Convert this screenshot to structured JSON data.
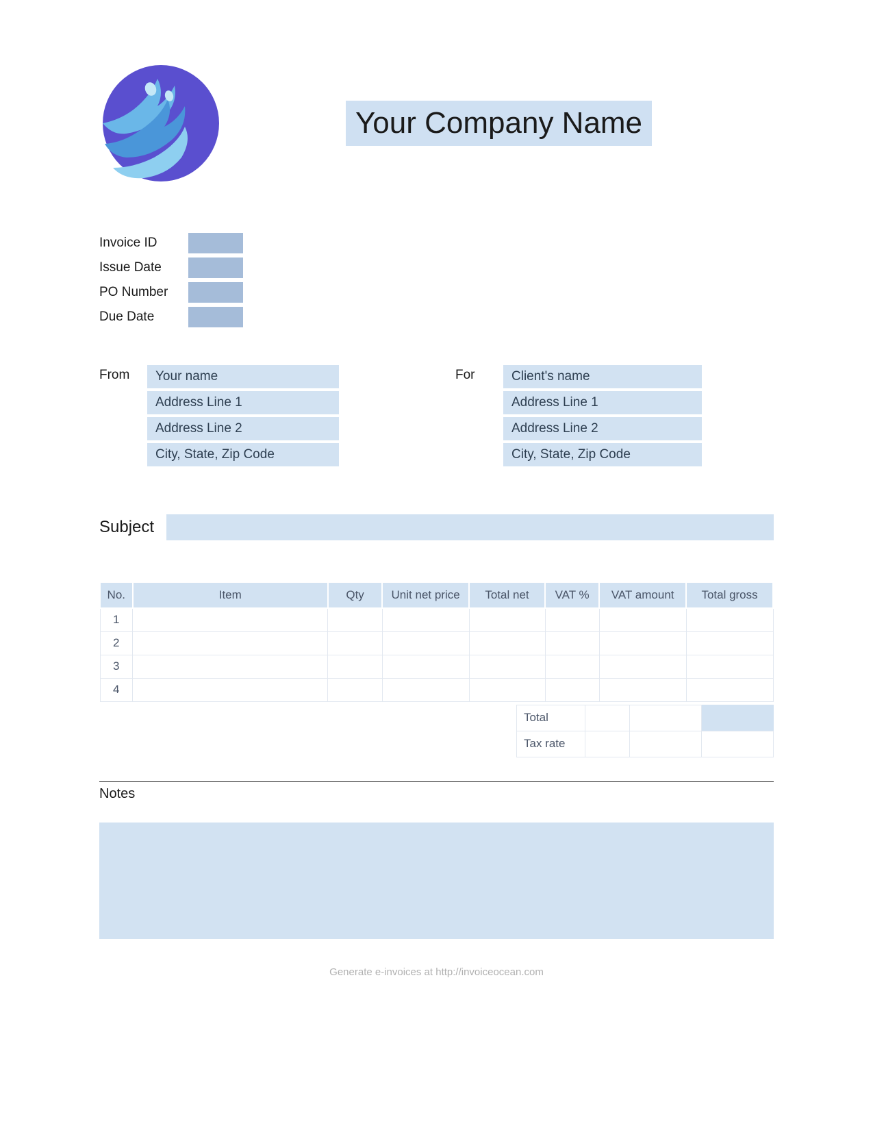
{
  "company_name": "Your Company Name",
  "meta": {
    "invoice_id_label": "Invoice ID",
    "invoice_id": "",
    "issue_date_label": "Issue Date",
    "issue_date": "",
    "po_number_label": "PO Number",
    "po_number": "",
    "due_date_label": "Due Date",
    "due_date": ""
  },
  "from": {
    "label": "From",
    "name": "Your name",
    "address1": "Address Line 1",
    "address2": "Address Line 2",
    "city": "City, State, Zip Code"
  },
  "for": {
    "label": "For",
    "name": "Client's name",
    "address1": "Address Line 1",
    "address2": "Address Line 2",
    "city": "City, State, Zip Code"
  },
  "subject_label": "Subject",
  "subject": "",
  "table": {
    "headers": {
      "no": "No.",
      "item": "Item",
      "qty": "Qty",
      "unit_net_price": "Unit net price",
      "total_net": "Total net",
      "vat_pct": "VAT %",
      "vat_amount": "VAT amount",
      "total_gross": "Total gross"
    },
    "rows": [
      {
        "no": "1",
        "item": "",
        "qty": "",
        "unit_net_price": "",
        "total_net": "",
        "vat_pct": "",
        "vat_amount": "",
        "total_gross": ""
      },
      {
        "no": "2",
        "item": "",
        "qty": "",
        "unit_net_price": "",
        "total_net": "",
        "vat_pct": "",
        "vat_amount": "",
        "total_gross": ""
      },
      {
        "no": "3",
        "item": "",
        "qty": "",
        "unit_net_price": "",
        "total_net": "",
        "vat_pct": "",
        "vat_amount": "",
        "total_gross": ""
      },
      {
        "no": "4",
        "item": "",
        "qty": "",
        "unit_net_price": "",
        "total_net": "",
        "vat_pct": "",
        "vat_amount": "",
        "total_gross": ""
      }
    ]
  },
  "totals": {
    "total_label": "Total",
    "total_vat_pct": "",
    "total_vat_amount": "",
    "total_gross": "",
    "tax_rate_label": "Tax rate",
    "tax_rate_vat_pct": "",
    "tax_rate_vat_amount": "",
    "tax_rate_gross": ""
  },
  "notes_label": "Notes",
  "notes": "",
  "footer": "Generate e-invoices at http://invoiceocean.com"
}
